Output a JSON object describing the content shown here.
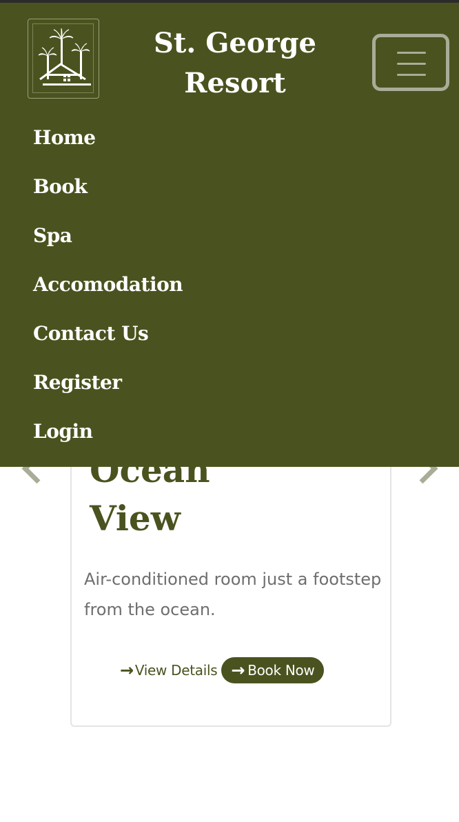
{
  "header": {
    "brand_line1": "St. George",
    "brand_line2": "Resort"
  },
  "nav": {
    "toggle_icon": "hamburger-icon",
    "items": [
      {
        "label": "Home"
      },
      {
        "label": "Book"
      },
      {
        "label": "Spa"
      },
      {
        "label": "Accomodation"
      },
      {
        "label": "Contact Us"
      },
      {
        "label": "Register"
      },
      {
        "label": "Login"
      }
    ]
  },
  "card": {
    "title_line1": "Ocean",
    "title_line2": "View",
    "description": "Air-conditioned room just a footstep from the ocean.",
    "details_label": "View Details",
    "book_label": "Book Now",
    "arrow_glyph": "→"
  },
  "colors": {
    "brand_green": "#4a531f",
    "muted_sage": "#a9ad97",
    "text_gray": "#6e6e6e"
  }
}
